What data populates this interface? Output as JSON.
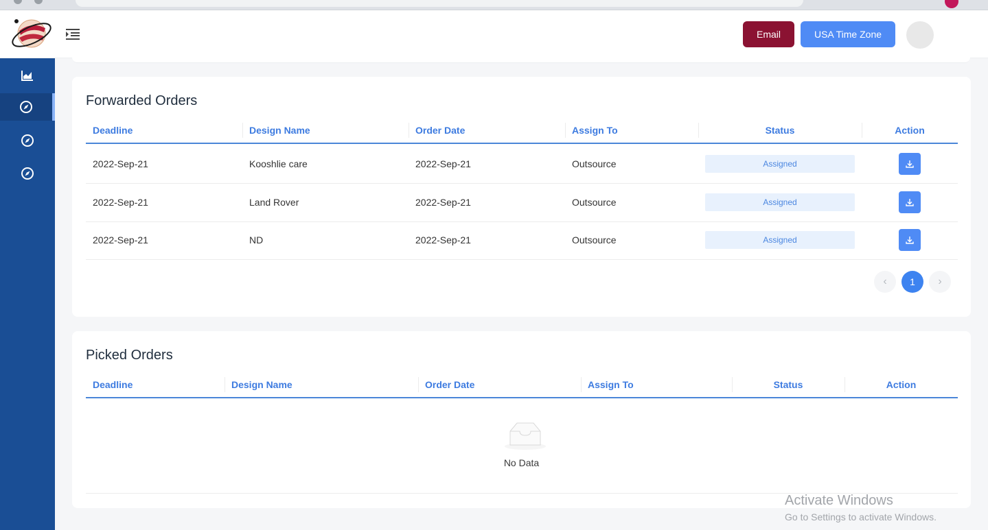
{
  "header": {
    "email_label": "Email",
    "timezone_label": "USA Time Zone"
  },
  "sidebar": {
    "items": [
      {
        "icon": "chart-icon",
        "active": false
      },
      {
        "icon": "compass-icon",
        "active": true
      },
      {
        "icon": "compass-icon",
        "active": false
      },
      {
        "icon": "compass-icon",
        "active": false
      }
    ]
  },
  "forwarded": {
    "title": "Forwarded Orders",
    "columns": [
      "Deadline",
      "Design Name",
      "Order Date",
      "Assign To",
      "Status",
      "Action"
    ],
    "rows": [
      {
        "deadline": "2022-Sep-21",
        "design": "Kooshlie care",
        "order_date": "2022-Sep-21",
        "assign": "Outsource",
        "status": "Assigned"
      },
      {
        "deadline": "2022-Sep-21",
        "design": "Land Rover",
        "order_date": "2022-Sep-21",
        "assign": "Outsource",
        "status": "Assigned"
      },
      {
        "deadline": "2022-Sep-21",
        "design": "ND",
        "order_date": "2022-Sep-21",
        "assign": "Outsource",
        "status": "Assigned"
      }
    ],
    "pagination": {
      "prev": "‹",
      "current": "1",
      "next": "›"
    }
  },
  "picked": {
    "title": "Picked Orders",
    "columns": [
      "Deadline",
      "Design Name",
      "Order Date",
      "Assign To",
      "Status",
      "Action"
    ],
    "empty_text": "No Data"
  },
  "watermark": {
    "line1": "Activate Windows",
    "line2": "Go to Settings to activate Windows."
  },
  "colors": {
    "sidebar": "#1a4e95",
    "email_button": "#8b1232",
    "primary": "#4f8bf5",
    "header_text": "#3d7be0"
  }
}
